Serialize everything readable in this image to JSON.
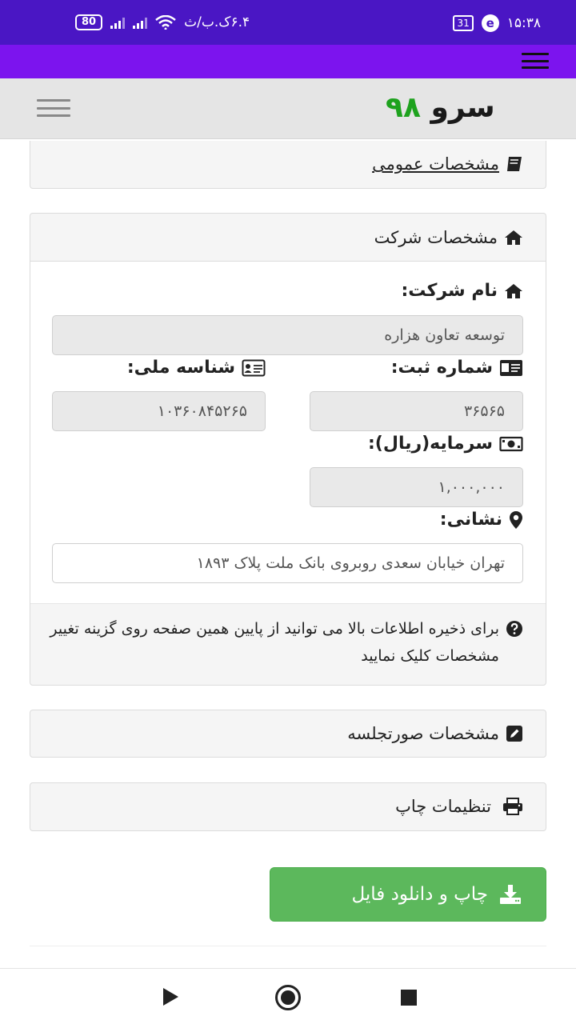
{
  "status_bar": {
    "time": "۱۵:۳۸",
    "calendar": "31",
    "app_icon": "e",
    "speed": "۶.۴ک.ب/ث",
    "battery": "80"
  },
  "site": {
    "logo_word1": "سرو",
    "logo_word2": "۹۸"
  },
  "sections": {
    "general": "مشخصات عمومی",
    "company": "مشخصات شرکت",
    "minutes": "مشخصات صورتجلسه",
    "print": "تنظیمات چاپ"
  },
  "company": {
    "name_label": "نام شرکت:",
    "name_value": "توسعه تعاون هزاره",
    "reg_label": "شماره ثبت:",
    "reg_value": "۳۶۵۶۵",
    "national_label": "شناسه ملی:",
    "national_value": "۱۰۳۶۰۸۴۵۲۶۵",
    "capital_label": "سرمایه(ریال):",
    "capital_value": "۱,۰۰۰,۰۰۰",
    "address_label": "نشانی:",
    "address_value": "تهران خیابان سعدی روبروی بانک ملت پلاک ۱۸۹۳",
    "help_text": "برای ذخیره اطلاعات بالا می توانید از پایین همین صفحه روی گزینه تغییر مشخصات کلیک نمایید"
  },
  "download_button": "چاپ و دانلود فایل",
  "icons": {
    "menu": "hamburger-icon",
    "book": "book-icon",
    "home": "home-icon",
    "id_card": "id-card-icon",
    "money": "money-icon",
    "marker": "map-marker-icon",
    "question": "question-circle-icon",
    "edit": "edit-icon",
    "print": "print-icon",
    "download": "download-icon"
  },
  "colors": {
    "status_bar": "#4a16c4",
    "toolbar": "#7c14ee",
    "logo_green": "#1ea21e",
    "button_green": "#5cb85c"
  }
}
